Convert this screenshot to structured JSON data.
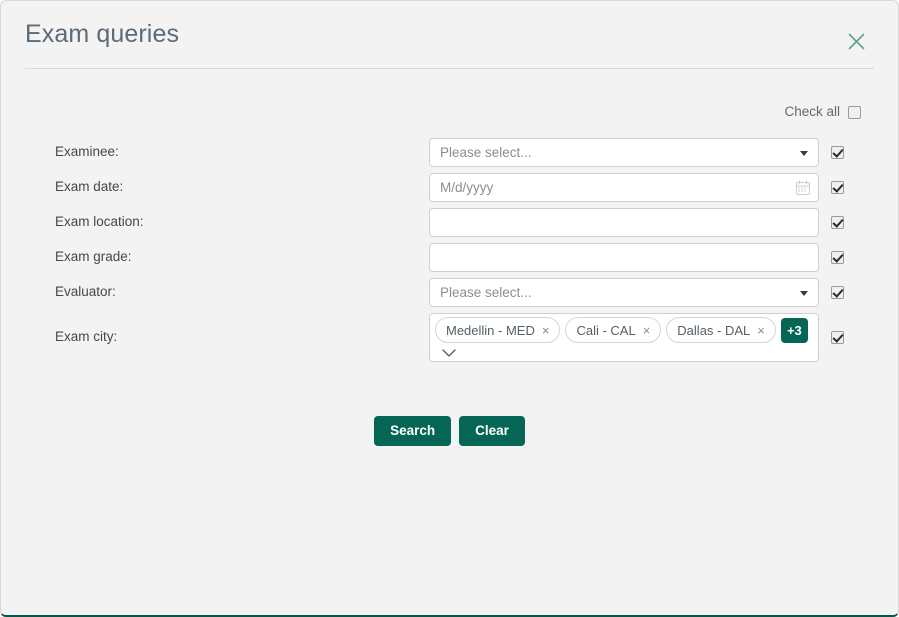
{
  "modal": {
    "title": "Exam queries",
    "close_icon": "close-icon"
  },
  "check_all": {
    "label": "Check all",
    "checked": false
  },
  "fields": [
    {
      "label": "Examinee:",
      "type": "select",
      "value": "",
      "placeholder": "Please select...",
      "checked": true
    },
    {
      "label": "Exam date:",
      "type": "date",
      "value": "",
      "placeholder": "M/d/yyyy",
      "checked": true
    },
    {
      "label": "Exam location:",
      "type": "text",
      "value": "",
      "placeholder": "",
      "checked": true
    },
    {
      "label": "Exam grade:",
      "type": "text",
      "value": "",
      "placeholder": "",
      "checked": true
    },
    {
      "label": "Evaluator:",
      "type": "select",
      "value": "",
      "placeholder": "Please select...",
      "checked": true
    },
    {
      "label": "Exam city:",
      "type": "multiselect",
      "checked": true,
      "chips": [
        {
          "text": "Medellin - MED",
          "remove": "×"
        },
        {
          "text": "Cali - CAL",
          "remove": "×"
        },
        {
          "text": "Dallas - DAL",
          "remove": "×"
        }
      ],
      "more_badge": "+3"
    }
  ],
  "actions": {
    "search_label": "Search",
    "clear_label": "Clear"
  },
  "colors": {
    "accent": "#056655",
    "title": "#5c6b78",
    "label": "#474747",
    "background": "#f3f3f3",
    "border": "#cfcfcf"
  }
}
